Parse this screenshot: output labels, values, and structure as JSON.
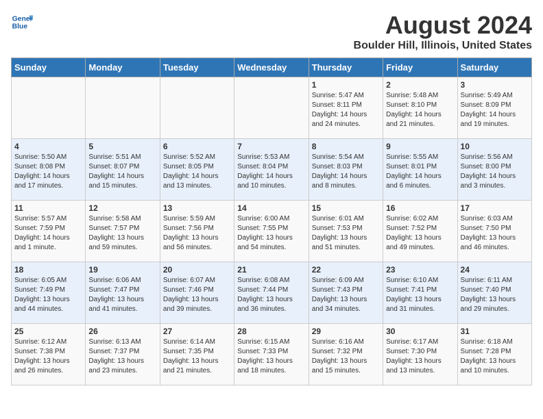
{
  "logo": {
    "line1": "General",
    "line2": "Blue"
  },
  "title": "August 2024",
  "subtitle": "Boulder Hill, Illinois, United States",
  "days_of_week": [
    "Sunday",
    "Monday",
    "Tuesday",
    "Wednesday",
    "Thursday",
    "Friday",
    "Saturday"
  ],
  "weeks": [
    [
      {
        "day": "",
        "info": ""
      },
      {
        "day": "",
        "info": ""
      },
      {
        "day": "",
        "info": ""
      },
      {
        "day": "",
        "info": ""
      },
      {
        "day": "1",
        "info": "Sunrise: 5:47 AM\nSunset: 8:11 PM\nDaylight: 14 hours\nand 24 minutes."
      },
      {
        "day": "2",
        "info": "Sunrise: 5:48 AM\nSunset: 8:10 PM\nDaylight: 14 hours\nand 21 minutes."
      },
      {
        "day": "3",
        "info": "Sunrise: 5:49 AM\nSunset: 8:09 PM\nDaylight: 14 hours\nand 19 minutes."
      }
    ],
    [
      {
        "day": "4",
        "info": "Sunrise: 5:50 AM\nSunset: 8:08 PM\nDaylight: 14 hours\nand 17 minutes."
      },
      {
        "day": "5",
        "info": "Sunrise: 5:51 AM\nSunset: 8:07 PM\nDaylight: 14 hours\nand 15 minutes."
      },
      {
        "day": "6",
        "info": "Sunrise: 5:52 AM\nSunset: 8:05 PM\nDaylight: 14 hours\nand 13 minutes."
      },
      {
        "day": "7",
        "info": "Sunrise: 5:53 AM\nSunset: 8:04 PM\nDaylight: 14 hours\nand 10 minutes."
      },
      {
        "day": "8",
        "info": "Sunrise: 5:54 AM\nSunset: 8:03 PM\nDaylight: 14 hours\nand 8 minutes."
      },
      {
        "day": "9",
        "info": "Sunrise: 5:55 AM\nSunset: 8:01 PM\nDaylight: 14 hours\nand 6 minutes."
      },
      {
        "day": "10",
        "info": "Sunrise: 5:56 AM\nSunset: 8:00 PM\nDaylight: 14 hours\nand 3 minutes."
      }
    ],
    [
      {
        "day": "11",
        "info": "Sunrise: 5:57 AM\nSunset: 7:59 PM\nDaylight: 14 hours\nand 1 minute."
      },
      {
        "day": "12",
        "info": "Sunrise: 5:58 AM\nSunset: 7:57 PM\nDaylight: 13 hours\nand 59 minutes."
      },
      {
        "day": "13",
        "info": "Sunrise: 5:59 AM\nSunset: 7:56 PM\nDaylight: 13 hours\nand 56 minutes."
      },
      {
        "day": "14",
        "info": "Sunrise: 6:00 AM\nSunset: 7:55 PM\nDaylight: 13 hours\nand 54 minutes."
      },
      {
        "day": "15",
        "info": "Sunrise: 6:01 AM\nSunset: 7:53 PM\nDaylight: 13 hours\nand 51 minutes."
      },
      {
        "day": "16",
        "info": "Sunrise: 6:02 AM\nSunset: 7:52 PM\nDaylight: 13 hours\nand 49 minutes."
      },
      {
        "day": "17",
        "info": "Sunrise: 6:03 AM\nSunset: 7:50 PM\nDaylight: 13 hours\nand 46 minutes."
      }
    ],
    [
      {
        "day": "18",
        "info": "Sunrise: 6:05 AM\nSunset: 7:49 PM\nDaylight: 13 hours\nand 44 minutes."
      },
      {
        "day": "19",
        "info": "Sunrise: 6:06 AM\nSunset: 7:47 PM\nDaylight: 13 hours\nand 41 minutes."
      },
      {
        "day": "20",
        "info": "Sunrise: 6:07 AM\nSunset: 7:46 PM\nDaylight: 13 hours\nand 39 minutes."
      },
      {
        "day": "21",
        "info": "Sunrise: 6:08 AM\nSunset: 7:44 PM\nDaylight: 13 hours\nand 36 minutes."
      },
      {
        "day": "22",
        "info": "Sunrise: 6:09 AM\nSunset: 7:43 PM\nDaylight: 13 hours\nand 34 minutes."
      },
      {
        "day": "23",
        "info": "Sunrise: 6:10 AM\nSunset: 7:41 PM\nDaylight: 13 hours\nand 31 minutes."
      },
      {
        "day": "24",
        "info": "Sunrise: 6:11 AM\nSunset: 7:40 PM\nDaylight: 13 hours\nand 29 minutes."
      }
    ],
    [
      {
        "day": "25",
        "info": "Sunrise: 6:12 AM\nSunset: 7:38 PM\nDaylight: 13 hours\nand 26 minutes."
      },
      {
        "day": "26",
        "info": "Sunrise: 6:13 AM\nSunset: 7:37 PM\nDaylight: 13 hours\nand 23 minutes."
      },
      {
        "day": "27",
        "info": "Sunrise: 6:14 AM\nSunset: 7:35 PM\nDaylight: 13 hours\nand 21 minutes."
      },
      {
        "day": "28",
        "info": "Sunrise: 6:15 AM\nSunset: 7:33 PM\nDaylight: 13 hours\nand 18 minutes."
      },
      {
        "day": "29",
        "info": "Sunrise: 6:16 AM\nSunset: 7:32 PM\nDaylight: 13 hours\nand 15 minutes."
      },
      {
        "day": "30",
        "info": "Sunrise: 6:17 AM\nSunset: 7:30 PM\nDaylight: 13 hours\nand 13 minutes."
      },
      {
        "day": "31",
        "info": "Sunrise: 6:18 AM\nSunset: 7:28 PM\nDaylight: 13 hours\nand 10 minutes."
      }
    ]
  ]
}
